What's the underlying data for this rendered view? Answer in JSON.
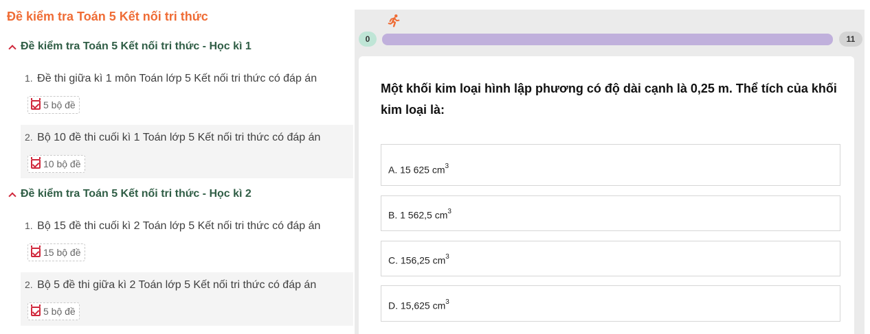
{
  "left": {
    "title": "Đề kiểm tra Toán 5 Kết nối tri thức",
    "sections": [
      {
        "heading": "Đề kiểm tra Toán 5 Kết nối tri thức - Học kì 1",
        "items": [
          {
            "num": "1.",
            "label": "Đề thi giữa kì 1 môn Toán lớp 5 Kết nối tri thức có đáp án",
            "badge": "5 bộ đề"
          },
          {
            "num": "2.",
            "label": "Bộ 10 đề thi cuối kì 1 Toán lớp 5 Kết nối tri thức có đáp án",
            "badge": "10 bộ đề"
          }
        ]
      },
      {
        "heading": "Đề kiểm tra Toán 5 Kết nối tri thức - Học kì 2",
        "items": [
          {
            "num": "1.",
            "label": "Bộ 15 đề thi cuối kì 2 Toán lớp 5 Kết nối tri thức có đáp án",
            "badge": "15 bộ đề"
          },
          {
            "num": "2.",
            "label": "Bộ 5 đề thi giữa kì 2 Toán lớp 5 Kết nối tri thức có đáp án",
            "badge": "5 bộ đề"
          }
        ]
      }
    ]
  },
  "quiz": {
    "progress": {
      "start": "0",
      "end": "11",
      "fraction": 1.0
    },
    "question": "Một khối kim loại hình lập phương có độ dài cạnh là 0,25 m. Thể tích của khối kim loại là:",
    "options": [
      {
        "text": "A. 15 625 cm",
        "sup": "3"
      },
      {
        "text": "B. 1 562,5 cm",
        "sup": "3"
      },
      {
        "text": "C. 156,25 cm",
        "sup": "3"
      },
      {
        "text": "D. 15,625 cm",
        "sup": "3"
      }
    ]
  },
  "icons": {
    "runner": "running-person-icon",
    "caret": "chevron-up-icon",
    "badge": "calendar-check-icon"
  },
  "colors": {
    "title": "#ef6c35",
    "heading": "#2f5d45",
    "accent": "#d0273b",
    "progress": "#c0b0dc",
    "start_pill": "#bfe5d6"
  }
}
